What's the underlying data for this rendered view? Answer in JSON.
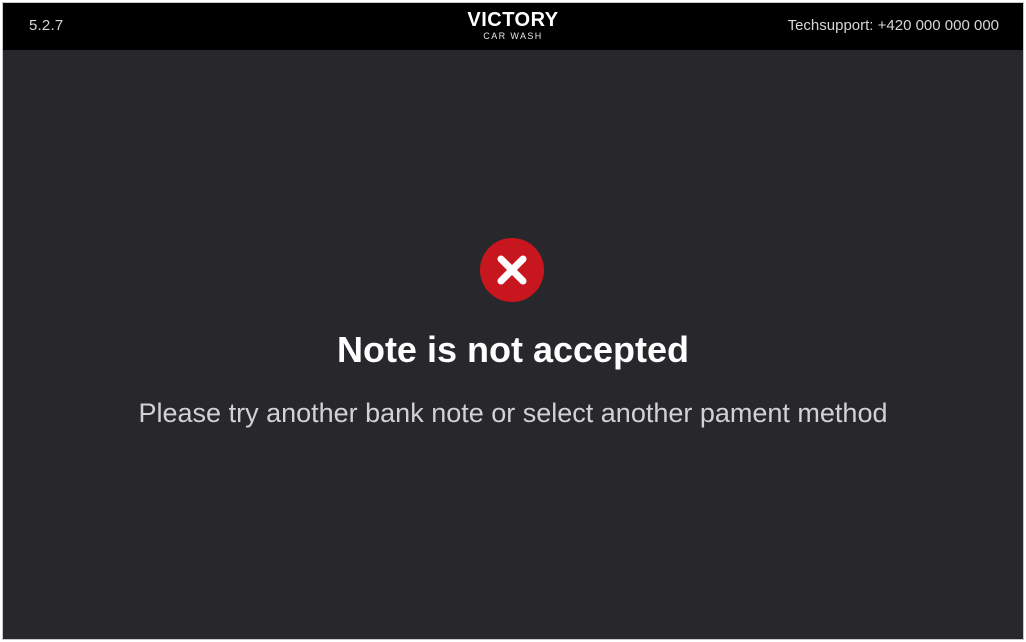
{
  "header": {
    "version": "5.2.7",
    "logo_title": "VICTORY",
    "logo_subtitle": "CAR WASH",
    "techsupport": "Techsupport: +420 000 000 000"
  },
  "dialog": {
    "icon": "close-x-icon",
    "icon_color": "#c8161e",
    "title": "Note is not accepted",
    "message": "Please try another bank note or select another pament method"
  },
  "colors": {
    "background": "#28282c",
    "topbar": "#000000",
    "title_text": "#ffffff",
    "message_text": "#d2d2d2"
  }
}
